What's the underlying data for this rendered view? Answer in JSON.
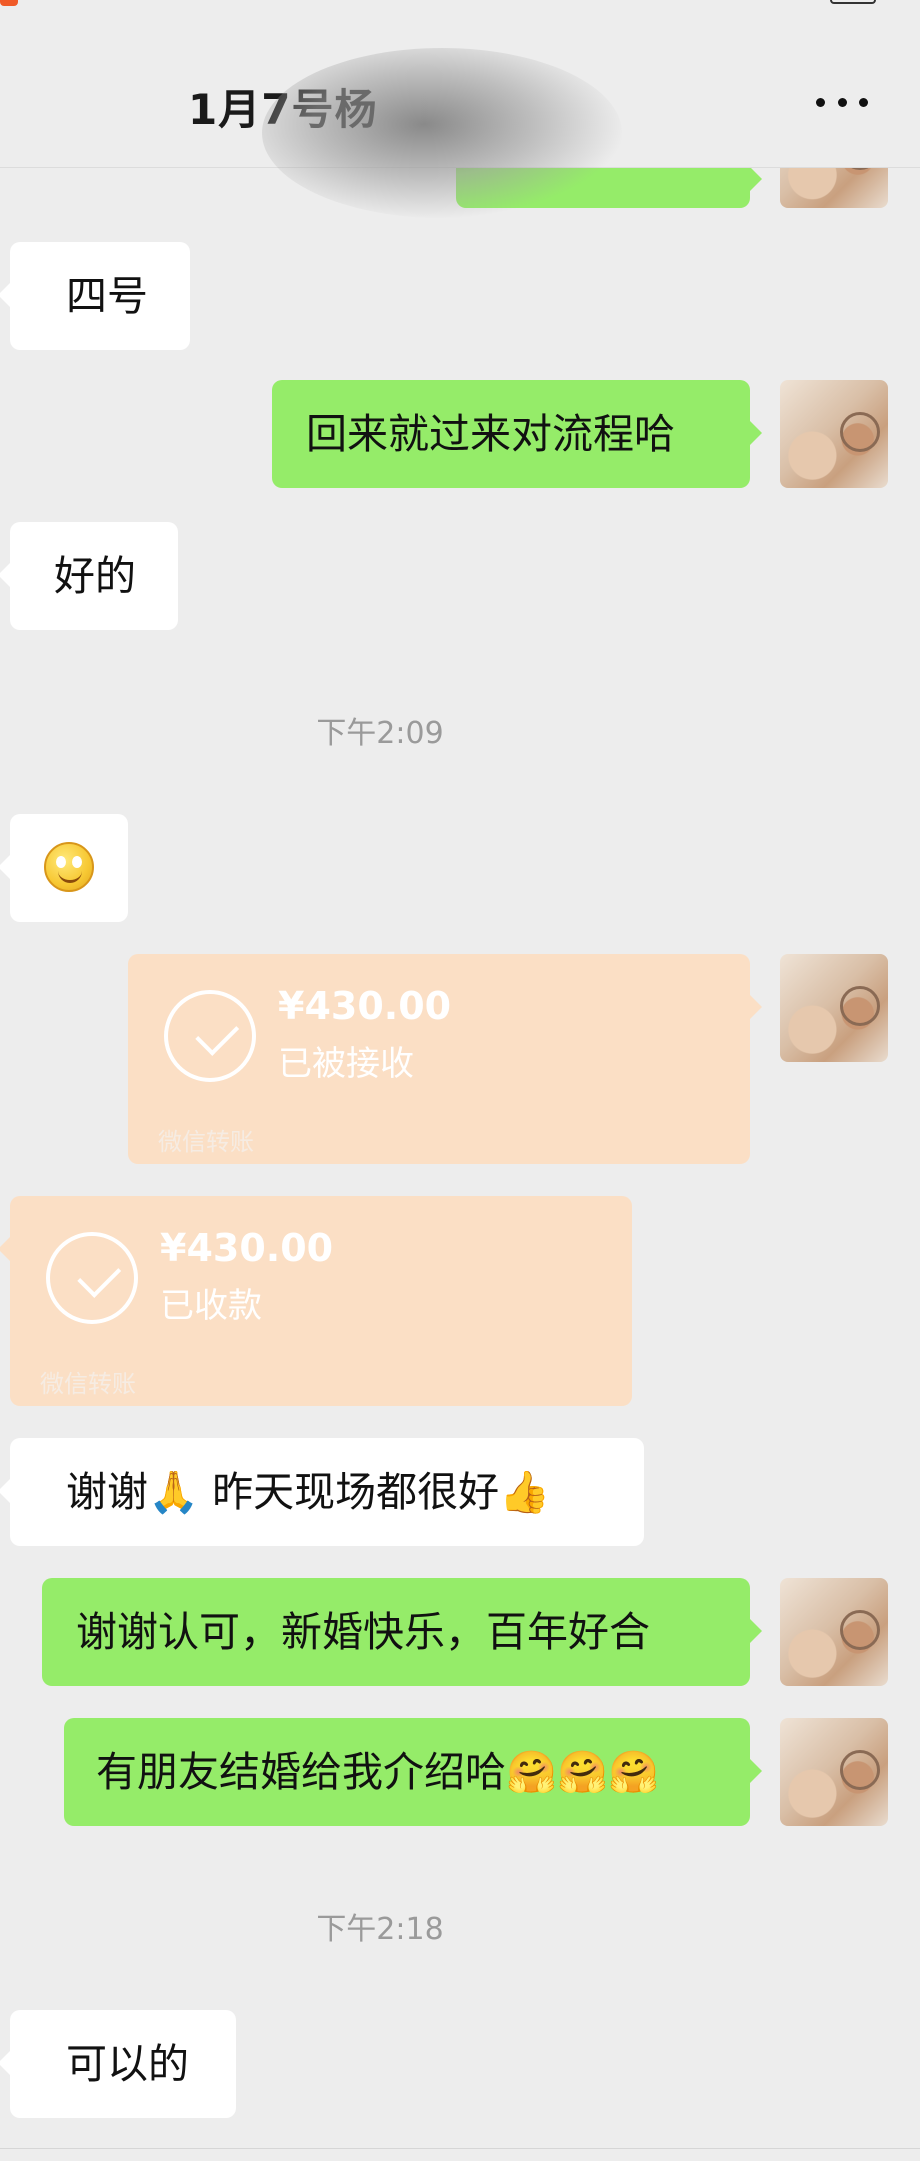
{
  "header": {
    "title": "1月7号杨",
    "more_icon": "more-dots-icon"
  },
  "messages": {
    "m1": {
      "text": "四号"
    },
    "m2": {
      "text": "回来就过来对流程哈"
    },
    "m3": {
      "text": "好的"
    },
    "time1": {
      "text": "下午2:09"
    },
    "m4": {
      "icon": "smiley-emoji-icon"
    },
    "transfer_out": {
      "amount": "¥430.00",
      "status": "已被接收",
      "footer": "微信转账"
    },
    "transfer_in": {
      "amount": "¥430.00",
      "status": "已收款",
      "footer": "微信转账"
    },
    "m5": {
      "text": "谢谢🙏 昨天现场都很好👍"
    },
    "m6": {
      "text": "谢谢认可，新婚快乐，百年好合"
    },
    "m7": {
      "text": "有朋友结婚给我介绍哈🤗🤗🤗"
    },
    "time2": {
      "text": "下午2:18"
    },
    "m8": {
      "text": "可以的"
    }
  },
  "colors": {
    "background": "#ededed",
    "outgoing_bubble": "#95ec69",
    "incoming_bubble": "#ffffff",
    "transfer_card": "#fbdfc5"
  }
}
